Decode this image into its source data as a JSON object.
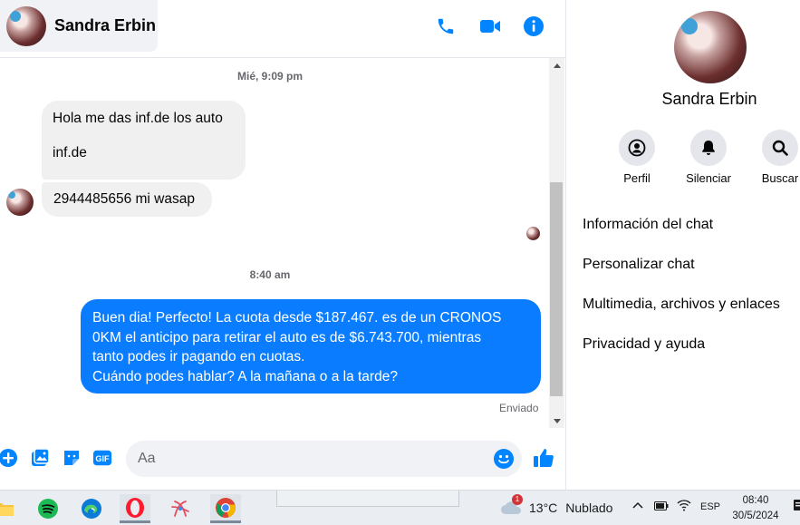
{
  "header": {
    "contact_name": "Sandra Erbin",
    "icons": [
      "phone-icon",
      "video-camera-icon",
      "info-icon"
    ]
  },
  "conversation": {
    "timestamp_1": "Mié, 9:09 pm",
    "incoming": [
      {
        "line1": "Hola me das inf.de los auto",
        "line2": "inf.de"
      },
      {
        "text": "2944485656 mi wasap"
      }
    ],
    "timestamp_2": "8:40 am",
    "outgoing": {
      "lines": [
        "Buen dia! Perfecto! La cuota desde $187.467. es de un CRONOS",
        "0KM el anticipo para retirar el auto es de $6.743.700, mientras",
        "tanto podes ir pagando en cuotas.",
        "Cuándo podes hablar? A la mañana o a la tarde?"
      ],
      "status": "Enviado"
    }
  },
  "composer": {
    "placeholder": "Aa",
    "icons": [
      "plus-icon",
      "photo-icon",
      "sticker-icon",
      "gif-icon",
      "emoji-icon",
      "thumbs-up-icon"
    ],
    "gif_label": "GIF"
  },
  "panel": {
    "name": "Sandra Erbin",
    "actions": [
      {
        "label": "Perfil",
        "icon": "profile-icon"
      },
      {
        "label": "Silenciar",
        "icon": "bell-icon"
      },
      {
        "label": "Buscar",
        "icon": "search-icon"
      }
    ],
    "menu": [
      "Información del chat",
      "Personalizar chat",
      "Multimedia, archivos y enlaces",
      "Privacidad y ayuda"
    ]
  },
  "taskbar": {
    "apps": [
      "file-explorer-icon",
      "spotify-icon",
      "edge-icon",
      "opera-icon",
      "app-icon",
      "chrome-icon"
    ],
    "weather_badge": "1",
    "temperature": "13°C",
    "condition": "Nublado",
    "language": "ESP",
    "time": "08:40",
    "date": "30/5/2024"
  },
  "colors": {
    "messenger_blue": "#0a7cff",
    "icon_blue": "#0084ff",
    "incoming_bubble": "#f0f0f0"
  }
}
